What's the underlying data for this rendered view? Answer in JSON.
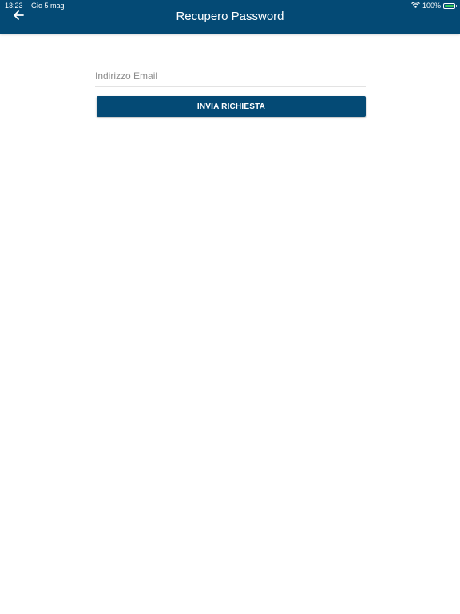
{
  "status_bar": {
    "time": "13:23",
    "date": "Gio 5 mag",
    "battery_percent": "100%",
    "battery_level": 1.0,
    "icons": [
      "wifi-icon",
      "battery-icon"
    ]
  },
  "header": {
    "title": "Recupero Password",
    "back_icon": "arrow-left-icon"
  },
  "form": {
    "email_placeholder": "Indirizzo Email",
    "email_value": "",
    "submit_label": "INVIA RICHIESTA"
  },
  "colors": {
    "primary": "#044a75",
    "background": "#ffffff",
    "battery_charging": "#35c759"
  }
}
